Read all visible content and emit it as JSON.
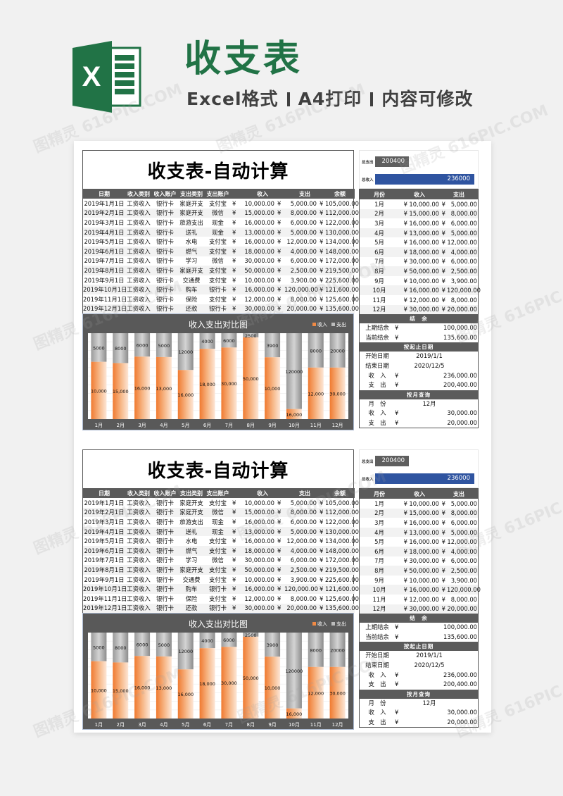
{
  "hero": {
    "title": "收支表",
    "subtitle_parts": [
      "Excel格式",
      "A4打印",
      "内容可修改"
    ],
    "brand_color": "#217346",
    "logo_letter": "X"
  },
  "watermark": "图精灵 616PIC.COM",
  "sheet": {
    "title": "收支表-自动计算",
    "columns": [
      "日期",
      "收入类别",
      "收入账户",
      "支出类别",
      "支出账户",
      "",
      "收入",
      "",
      "支出",
      "",
      "余额"
    ],
    "rows": [
      {
        "date": "2019年1月1日",
        "in_type": "工资收入",
        "in_acct": "银行卡",
        "out_type": "家庭开支",
        "out_acct": "支付宝",
        "income": "10,000.00",
        "expense": "5,000.00",
        "balance": "105,000.00"
      },
      {
        "date": "2019年2月1日",
        "in_type": "工资收入",
        "in_acct": "银行卡",
        "out_type": "家庭开支",
        "out_acct": "微信",
        "income": "15,000.00",
        "expense": "8,000.00",
        "balance": "112,000.00"
      },
      {
        "date": "2019年3月1日",
        "in_type": "工资收入",
        "in_acct": "银行卡",
        "out_type": "旅游支出",
        "out_acct": "现金",
        "income": "16,000.00",
        "expense": "6,000.00",
        "balance": "122,000.00"
      },
      {
        "date": "2019年4月1日",
        "in_type": "工资收入",
        "in_acct": "银行卡",
        "out_type": "送礼",
        "out_acct": "现金",
        "income": "13,000.00",
        "expense": "5,000.00",
        "balance": "130,000.00"
      },
      {
        "date": "2019年5月1日",
        "in_type": "工资收入",
        "in_acct": "银行卡",
        "out_type": "水电",
        "out_acct": "支付宝",
        "income": "16,000.00",
        "expense": "12,000.00",
        "balance": "134,000.00"
      },
      {
        "date": "2019年6月1日",
        "in_type": "工资收入",
        "in_acct": "银行卡",
        "out_type": "燃气",
        "out_acct": "支付宝",
        "income": "18,000.00",
        "expense": "4,000.00",
        "balance": "148,000.00"
      },
      {
        "date": "2019年7月1日",
        "in_type": "工资收入",
        "in_acct": "银行卡",
        "out_type": "学习",
        "out_acct": "微信",
        "income": "30,000.00",
        "expense": "6,000.00",
        "balance": "172,000.00"
      },
      {
        "date": "2019年8月1日",
        "in_type": "工资收入",
        "in_acct": "银行卡",
        "out_type": "家庭开支",
        "out_acct": "支付宝",
        "income": "50,000.00",
        "expense": "2,500.00",
        "balance": "219,500.00"
      },
      {
        "date": "2019年9月1日",
        "in_type": "工资收入",
        "in_acct": "银行卡",
        "out_type": "交通费",
        "out_acct": "支付宝",
        "income": "10,000.00",
        "expense": "3,900.00",
        "balance": "225,600.00"
      },
      {
        "date": "2019年10月1日",
        "in_type": "工资收入",
        "in_acct": "银行卡",
        "out_type": "购车",
        "out_acct": "银行卡",
        "income": "16,000.00",
        "expense": "120,000.00",
        "balance": "121,600.00"
      },
      {
        "date": "2019年11月1日",
        "in_type": "工资收入",
        "in_acct": "银行卡",
        "out_type": "保险",
        "out_acct": "支付宝",
        "income": "12,000.00",
        "expense": "8,000.00",
        "balance": "125,600.00"
      },
      {
        "date": "2019年12月1日",
        "in_type": "工资收入",
        "in_acct": "银行卡",
        "out_type": "还款",
        "out_acct": "银行卡",
        "income": "30,000.00",
        "expense": "20,000.00",
        "balance": "135,600.00"
      }
    ],
    "currency": "¥",
    "totals": {
      "expense_label": "总支出",
      "expense_value": "200400",
      "income_label": "总收入",
      "income_value": "236000",
      "expense_color": "#5e5e5e",
      "income_color": "#2f54a0"
    },
    "monthly": {
      "columns": [
        "月份",
        "收入",
        "支出"
      ],
      "rows": [
        {
          "month": "1月",
          "income": "10,000.00",
          "expense": "5,000.00"
        },
        {
          "month": "2月",
          "income": "15,000.00",
          "expense": "8,000.00"
        },
        {
          "month": "3月",
          "income": "16,000.00",
          "expense": "6,000.00"
        },
        {
          "month": "4月",
          "income": "13,000.00",
          "expense": "5,000.00"
        },
        {
          "month": "5月",
          "income": "16,000.00",
          "expense": "12,000.00"
        },
        {
          "month": "6月",
          "income": "18,000.00",
          "expense": "4,000.00"
        },
        {
          "month": "7月",
          "income": "30,000.00",
          "expense": "6,000.00"
        },
        {
          "month": "8月",
          "income": "50,000.00",
          "expense": "2,500.00"
        },
        {
          "month": "9月",
          "income": "10,000.00",
          "expense": "3,900.00"
        },
        {
          "month": "10月",
          "income": "16,000.00",
          "expense": "120,000.00"
        },
        {
          "month": "11月",
          "income": "12,000.00",
          "expense": "8,000.00"
        },
        {
          "month": "12月",
          "income": "30,000.00",
          "expense": "20,000.00"
        }
      ]
    },
    "balance_section": {
      "header": "结　余",
      "prev_label": "上期结余",
      "prev_value": "100,000.00",
      "curr_label": "当前结余",
      "curr_value": "135,600.00"
    },
    "date_range_section": {
      "header": "按起止日期",
      "start_label": "开始日期",
      "start_value": "2019/1/1",
      "end_label": "结束日期",
      "end_value": "2020/12/5",
      "income_label": "收　入",
      "income_value": "236,000.00",
      "expense_label": "支　出",
      "expense_value": "200,400.00"
    },
    "month_query_section": {
      "header": "按月查询",
      "month_label": "月　份",
      "month_value": "12月",
      "income_label": "收　入",
      "income_value": "30,000.00",
      "expense_label": "支　出",
      "expense_value": "20,000.00"
    }
  },
  "chart_data": {
    "type": "bar",
    "stacking": "percent",
    "title": "收入支出对比图",
    "categories": [
      "1月",
      "2月",
      "3月",
      "4月",
      "5月",
      "6月",
      "7月",
      "8月",
      "9月",
      "10月",
      "11月",
      "12月"
    ],
    "series": [
      {
        "name": "收入",
        "color": "#f08a45",
        "values": [
          10000,
          15000,
          16000,
          13000,
          16000,
          18000,
          30000,
          50000,
          10000,
          16000,
          12000,
          30000
        ],
        "labels": [
          "10,000",
          "15,000",
          "16,000",
          "13,000",
          "16,000",
          "18,000",
          "30,000",
          "50,000",
          "10,000",
          "16,000",
          "12,000",
          "30,000"
        ]
      },
      {
        "name": "支出",
        "color": "#a6a6a6",
        "values": [
          5000,
          8000,
          6000,
          5000,
          12000,
          4000,
          6000,
          2500,
          3900,
          120000,
          8000,
          20000
        ],
        "labels": [
          "5000",
          "8000",
          "6000",
          "5000",
          "12000",
          "4000",
          "6000",
          "2500",
          "3900",
          "120000",
          "8000",
          "20000"
        ]
      }
    ],
    "legend": "top-right",
    "grid": true,
    "xlabel": "",
    "ylabel": "",
    "ylim": [
      0,
      1
    ]
  }
}
